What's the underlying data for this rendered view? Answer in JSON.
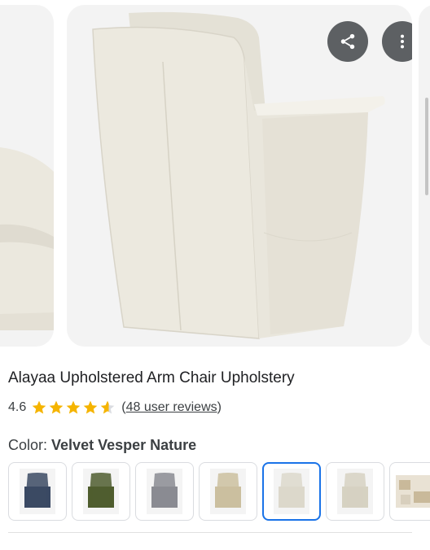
{
  "product": {
    "title": "Alayaa Upholstered Arm Chair Upholstery",
    "rating": "4.6",
    "rating_value": 4.6,
    "stars_max": 5,
    "reviews_open": "(",
    "reviews_text": "48 user reviews",
    "reviews_close": ")",
    "color_label": "Color:",
    "color_value": "Velvet Vesper Nature"
  },
  "actions": {
    "share": "share-icon",
    "more": "more-vert-icon",
    "close": "close-icon"
  },
  "swatches": [
    {
      "name": "navy",
      "color": "#3b4a63",
      "selected": false
    },
    {
      "name": "green",
      "color": "#4f5d2f",
      "selected": false
    },
    {
      "name": "gray",
      "color": "#8a8b92",
      "selected": false
    },
    {
      "name": "beige",
      "color": "#cbbf9f",
      "selected": false
    },
    {
      "name": "cream",
      "color": "#dcd8cb",
      "selected": true
    },
    {
      "name": "light-beige",
      "color": "#d6d1c2",
      "selected": false
    },
    {
      "name": "room",
      "color": "#c9b99a",
      "selected": false
    }
  ],
  "colors": {
    "star": "#f5b400",
    "selected_border": "#1a73e8",
    "chair": "#ece9df"
  }
}
